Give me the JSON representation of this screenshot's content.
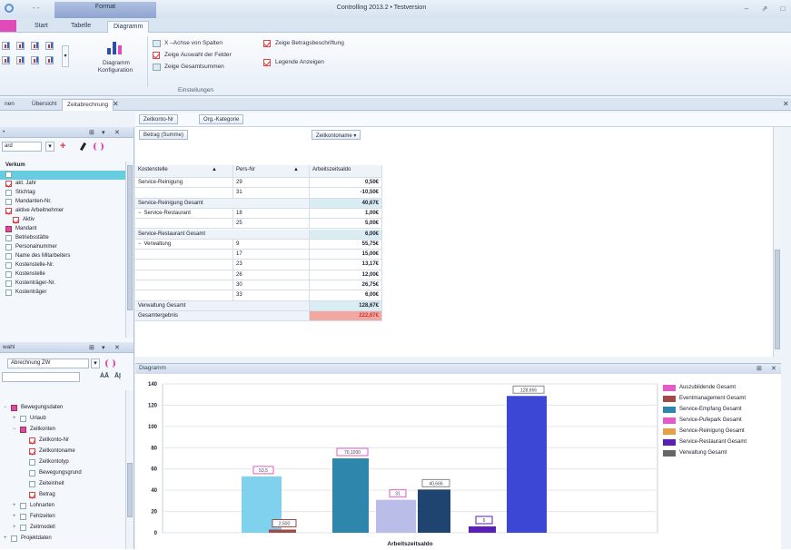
{
  "app": {
    "title": "Controlling 2013.2 • Testversion",
    "context_tab": "Format",
    "tabs": [
      "Start",
      "Tabelle",
      "Diagramm"
    ],
    "window_buttons": [
      "–",
      "⇗",
      "□"
    ]
  },
  "ribbon": {
    "config_label_1": "Diagramm",
    "config_label_2": "Konfiguration",
    "options": [
      {
        "label": "X –Achse von Spalten",
        "checked": false
      },
      {
        "label": "Zeige Auswahl der Felder",
        "checked": true
      },
      {
        "label": "Zeige Gesamtsummen",
        "checked": false
      }
    ],
    "options2": [
      {
        "label": "Zeige Betragsbeschriftung",
        "checked": true
      },
      {
        "label": "Legende Anzeigen",
        "checked": true
      }
    ],
    "group_label": "Einstellungen"
  },
  "doc_tabs": [
    "nen",
    "Übersicht",
    "Zeitabrechnung"
  ],
  "left_top": {
    "header": "•",
    "search_value": "ard",
    "items": [
      {
        "label": "Verkum",
        "checked": null,
        "highlight": false,
        "bold": true
      },
      {
        "label": "",
        "checked": false,
        "highlight": true
      },
      {
        "label": "akt. Jahr",
        "checked": true
      },
      {
        "label": "Stichtag",
        "checked": false
      },
      {
        "label": "Mandanten-Nr.",
        "checked": false
      },
      {
        "label": "aktive Arbeitnehmer",
        "checked": true
      },
      {
        "label": "Aktiv",
        "checked": true,
        "indent": true
      },
      {
        "label": "Mandant",
        "checked": false,
        "magenta": true
      },
      {
        "label": "Betriebsstätte",
        "checked": false
      },
      {
        "label": "Personalnummer",
        "checked": false
      },
      {
        "label": "Name des Mitarbeiters",
        "checked": false
      },
      {
        "label": "Kostenstelle-Nr.",
        "checked": false
      },
      {
        "label": "Kostenstelle",
        "checked": false
      },
      {
        "label": "Kostenträger-Nr.",
        "checked": false
      },
      {
        "label": "Kostenträger",
        "checked": false
      }
    ]
  },
  "left_bottom": {
    "header": "wahl",
    "select_value": "Abrechnung ZW",
    "items": [
      {
        "label": "Bewegungsdaten",
        "checked": false,
        "magenta": true,
        "level": 0,
        "expander": "−"
      },
      {
        "label": "Urlaub",
        "checked": false,
        "level": 1,
        "expander": "+"
      },
      {
        "label": "Zeitkonten",
        "checked": false,
        "magenta": true,
        "level": 1,
        "expander": "−"
      },
      {
        "label": "Zeitkonto-Nr",
        "checked": true,
        "level": 2
      },
      {
        "label": "Zeitkontoname",
        "checked": true,
        "level": 2
      },
      {
        "label": "Zeitkontotyp",
        "checked": false,
        "level": 2
      },
      {
        "label": "Bewegungsgrund",
        "checked": false,
        "level": 2
      },
      {
        "label": "Zeiteinheit",
        "checked": false,
        "level": 2
      },
      {
        "label": "Betrag",
        "checked": true,
        "level": 2
      },
      {
        "label": "Lohnarten",
        "checked": false,
        "level": 1,
        "expander": "+"
      },
      {
        "label": "Fehlzeiten",
        "checked": false,
        "level": 1,
        "expander": "+"
      },
      {
        "label": "Zeitmodell",
        "checked": false,
        "level": 1,
        "expander": "+"
      },
      {
        "label": "Projektdaten",
        "checked": false,
        "level": 0,
        "expander": "+"
      }
    ]
  },
  "pivot": {
    "filter_fields": [
      "Zeitkonto-Nr",
      "Org.-Kategorie"
    ],
    "data_field": "Betrag (Summe)",
    "column_field": "Zeitkontoname",
    "row_fields": [
      "Kostenstelle",
      "Pers-Nr"
    ],
    "column_header": "Arbeitszeitsaldo",
    "rows": [
      {
        "group": "Service-Reinigung",
        "pers": "29",
        "value": "0,50€",
        "type": "row"
      },
      {
        "group": "",
        "pers": "31",
        "value": "-10,50€",
        "type": "row"
      },
      {
        "group": "Service-Reinigung Gesamt",
        "pers": "",
        "value": "40,67€",
        "type": "total"
      },
      {
        "group": "Service-Restaurant",
        "pers": "18",
        "value": "1,00€",
        "type": "row",
        "expander": "−"
      },
      {
        "group": "",
        "pers": "25",
        "value": "5,00€",
        "type": "row"
      },
      {
        "group": "Service-Restaurant Gesamt",
        "pers": "",
        "value": "6,00€",
        "type": "total"
      },
      {
        "group": "Verwaltung",
        "pers": "9",
        "value": "55,75€",
        "type": "row",
        "expander": "−"
      },
      {
        "group": "",
        "pers": "17",
        "value": "15,00€",
        "type": "row"
      },
      {
        "group": "",
        "pers": "23",
        "value": "13,17€",
        "type": "row"
      },
      {
        "group": "",
        "pers": "26",
        "value": "12,00€",
        "type": "row"
      },
      {
        "group": "",
        "pers": "30",
        "value": "26,75€",
        "type": "row"
      },
      {
        "group": "",
        "pers": "33",
        "value": "6,00€",
        "type": "row"
      },
      {
        "group": "Verwaltung Gesamt",
        "pers": "",
        "value": "128,67€",
        "type": "total"
      },
      {
        "group": "Gesamtergebnis",
        "pers": "",
        "value": "222,67€",
        "type": "grand"
      }
    ]
  },
  "diagram": {
    "title": "Diagramm"
  },
  "chart_data": {
    "type": "bar",
    "xlabel": "Arbeitszeitsaldo",
    "ylim": [
      0,
      140
    ],
    "yticks": [
      0,
      20,
      40,
      60,
      80,
      100,
      120,
      140
    ],
    "series": [
      {
        "name": "Auszubildende Gesamt",
        "value": 53,
        "label": "53,5",
        "color": "#7fd1ee",
        "border": "#e35bc6"
      },
      {
        "name": "Eventmanagement Gesamt",
        "value": 3,
        "label": "2,500",
        "color": "#a24a45",
        "border": "#a24a45"
      },
      {
        "name": "Service-Empfang Gesamt",
        "value": 70,
        "label": "70,1000",
        "color": "#2f86ad",
        "border": "#e35bc6"
      },
      {
        "name": "Service-Pufepark Gesamt",
        "value": 31,
        "label": "31",
        "color": "#b9bde8",
        "border": "#e35bc6"
      },
      {
        "name": "Service-Reinigung Gesamt",
        "value": 40.67,
        "label": "40,666",
        "color": "#1f4470",
        "border": "#888888"
      },
      {
        "name": "Service-Restaurant Gesamt",
        "value": 6,
        "label": "6",
        "color": "#5a1fb4",
        "border": "#5a1fb4"
      },
      {
        "name": "Verwaltung Gesamt",
        "value": 128.67,
        "label": "128,666",
        "color": "#3d47d6",
        "border": "#888888"
      }
    ],
    "legend_colors": [
      "#e35bc6",
      "#a24a45",
      "#2f86ad",
      "#e35bc6",
      "#e2a24a",
      "#5a1fb4",
      "#666666"
    ]
  },
  "glyphs": {
    "pin": "⊞",
    "close": "✕",
    "expander_plus": "+",
    "expander_minus": "−",
    "filter": "▾",
    "sort": "▲"
  }
}
